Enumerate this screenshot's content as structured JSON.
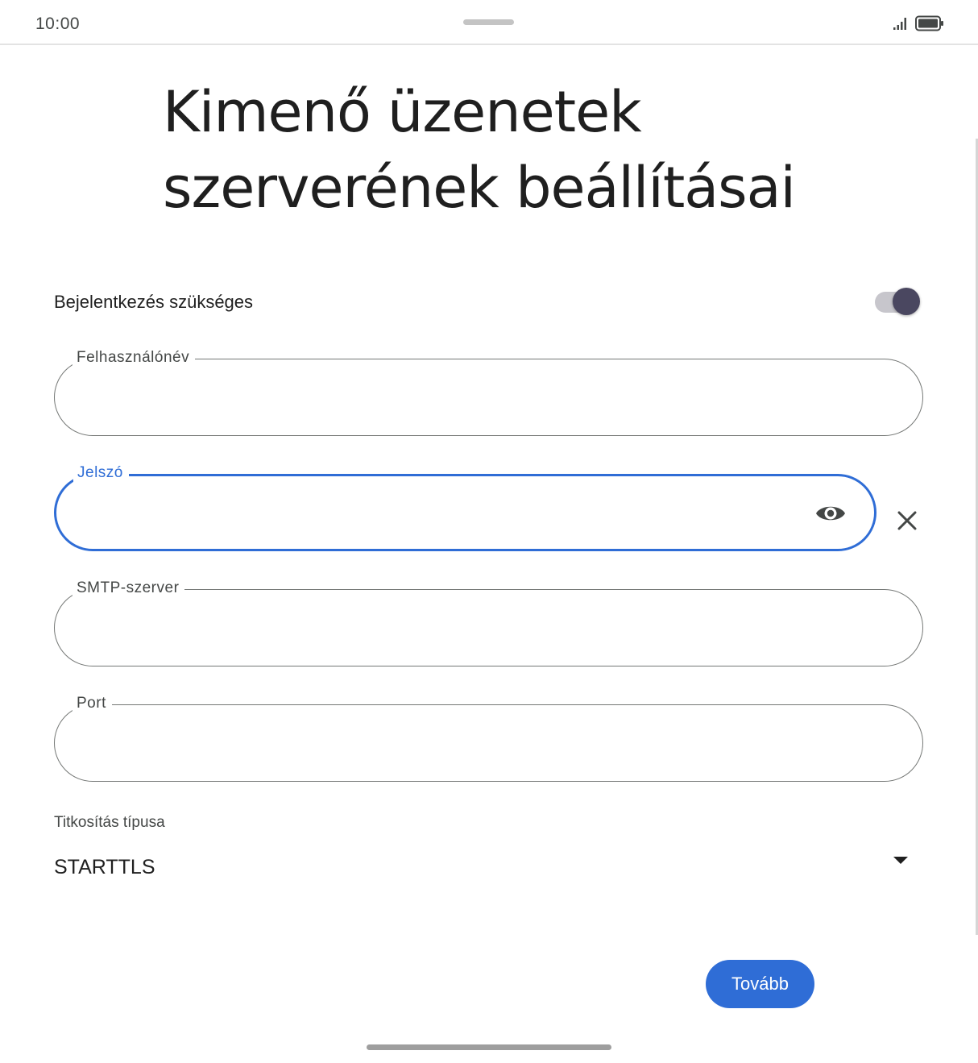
{
  "status_bar": {
    "time": "10:00",
    "icons": [
      "signal-icon",
      "battery-icon"
    ]
  },
  "page": {
    "title": "Kimenő üzenetek szerverének beállításai"
  },
  "login_toggle": {
    "label": "Bejelentkezés szükséges",
    "on": true
  },
  "fields": {
    "username": {
      "label": "Felhasználónév",
      "value": ""
    },
    "password": {
      "label": "Jelszó",
      "value": "",
      "focused": true
    },
    "smtp_server": {
      "label": "SMTP-szerver",
      "value": ""
    },
    "port": {
      "label": "Port",
      "value": ""
    }
  },
  "encryption": {
    "label": "Titkosítás típusa",
    "selected": "STARTTLS"
  },
  "actions": {
    "next_label": "Tovább"
  },
  "colors": {
    "accent": "#2f6dd6",
    "toggle_thumb": "#4a4760",
    "outline": "#747775"
  }
}
